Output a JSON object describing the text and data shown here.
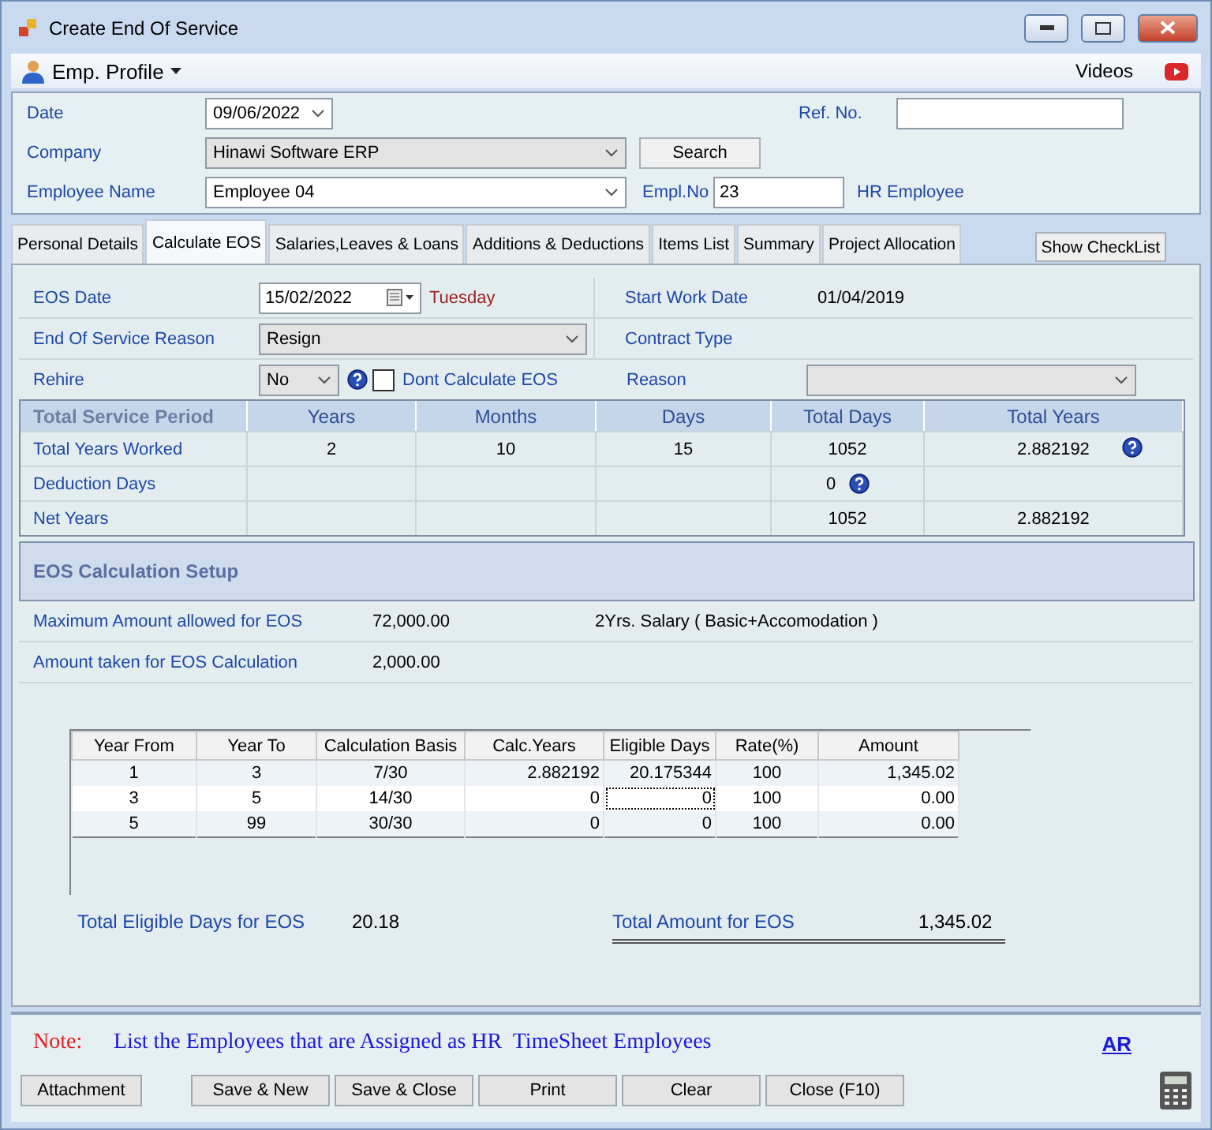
{
  "window": {
    "title": "Create End Of Service"
  },
  "toolbar": {
    "profile_menu": "Emp. Profile",
    "videos": "Videos"
  },
  "header": {
    "date_label": "Date",
    "date_value": "09/06/2022",
    "ref_label": "Ref. No.",
    "company_label": "Company",
    "company_value": "Hinawi Software ERP",
    "company_disabled": true,
    "search_button": "Search",
    "employee_label": "Employee Name",
    "employee_value": "Employee 04",
    "empl_no_label": "Empl.No",
    "empl_no_value": "23",
    "hr_employee": "HR Employee"
  },
  "tabs": [
    {
      "label": "Personal Details",
      "selected": false
    },
    {
      "label": "Calculate EOS",
      "selected": true
    },
    {
      "label": "Salaries,Leaves & Loans",
      "selected": false
    },
    {
      "label": "Additions & Deductions",
      "selected": false
    },
    {
      "label": "Items List",
      "selected": false
    },
    {
      "label": "Summary",
      "selected": false
    },
    {
      "label": "Project Allocation",
      "selected": false
    }
  ],
  "show_checklist_button": "Show CheckList",
  "eos": {
    "eos_date_label": "EOS Date",
    "eos_date_value": "15/02/2022",
    "weekday": "Tuesday",
    "start_label": "Start Work Date",
    "start_value": "01/04/2019",
    "reason_label": "End Of Service Reason",
    "reason_value": "Resign",
    "reason_disabled": true,
    "contract_label": "Contract Type",
    "rehire_label": "Rehire",
    "rehire_value": "No",
    "dont_calc_label": "Dont Calculate EOS",
    "dont_calc_checked": false,
    "reason2_label": "Reason",
    "reason2_disabled": true
  },
  "service_period": {
    "columns": [
      "Total Service Period",
      "Years",
      "Months",
      "Days",
      "Total Days",
      "Total Years"
    ],
    "rows": [
      {
        "cells": [
          {
            "text": "Total Years Worked"
          },
          {
            "text": "2",
            "help": false
          },
          {
            "text": "10",
            "help": false
          },
          {
            "text": "15",
            "help": false
          },
          {
            "text": "1052",
            "help": false
          },
          {
            "text": "2.882192",
            "help": true
          }
        ]
      },
      {
        "cells": [
          {
            "text": "Deduction Days"
          },
          {
            "text": "",
            "help": false
          },
          {
            "text": "",
            "help": false
          },
          {
            "text": "",
            "help": false
          },
          {
            "text": "0",
            "help": true
          },
          {
            "text": "",
            "help": false
          }
        ]
      },
      {
        "cells": [
          {
            "text": "Net Years"
          },
          {
            "text": "",
            "help": false
          },
          {
            "text": "",
            "help": false
          },
          {
            "text": "",
            "help": false
          },
          {
            "text": "1052",
            "help": false
          },
          {
            "text": "2.882192",
            "help": false
          }
        ]
      }
    ]
  },
  "setup": {
    "title": "EOS Calculation Setup",
    "rows": [
      {
        "label": "Maximum Amount allowed for EOS",
        "value": "72,000.00",
        "note": "2Yrs. Salary ( Basic+Accomodation )"
      },
      {
        "label": "Amount taken for EOS Calculation",
        "value": "2,000.00"
      }
    ]
  },
  "grid": {
    "columns": [
      "Year From",
      "Year To",
      "Calculation Basis",
      "Calc.Years",
      "Eligible Days",
      "Rate(%)",
      "Amount"
    ],
    "rows": [
      {
        "cells": [
          {
            "text": "1",
            "focused": false
          },
          {
            "text": "3",
            "focused": false
          },
          {
            "text": "7/30",
            "focused": false
          },
          {
            "text": "2.882192",
            "focused": false
          },
          {
            "text": "20.175344",
            "focused": false
          },
          {
            "text": "100",
            "focused": false
          },
          {
            "text": "1,345.02",
            "focused": false
          }
        ]
      },
      {
        "cells": [
          {
            "text": "3",
            "focused": false
          },
          {
            "text": "5",
            "focused": false
          },
          {
            "text": "14/30",
            "focused": false
          },
          {
            "text": "0",
            "focused": false
          },
          {
            "text": "0",
            "focused": true
          },
          {
            "text": "100",
            "focused": false
          },
          {
            "text": "0.00",
            "focused": false
          }
        ]
      },
      {
        "cells": [
          {
            "text": "5",
            "focused": false
          },
          {
            "text": "99",
            "focused": false
          },
          {
            "text": "30/30",
            "focused": false
          },
          {
            "text": "0",
            "focused": false
          },
          {
            "text": "0",
            "focused": false
          },
          {
            "text": "100",
            "focused": false
          },
          {
            "text": "0.00",
            "focused": false
          }
        ]
      }
    ]
  },
  "totals": {
    "eligible_label": "Total Eligible Days for EOS",
    "eligible_value": "20.18",
    "amount_label": "Total Amount for EOS",
    "amount_value": "1,345.02"
  },
  "footer": {
    "note_label": "Note:",
    "note_text": "List the Employees that are Assigned as HR  TimeSheet Employees",
    "ar_link": "AR",
    "buttons": [
      "Attachment",
      "Save & New",
      "Save & Close",
      "Print",
      "Clear",
      "Close (F10)"
    ]
  }
}
